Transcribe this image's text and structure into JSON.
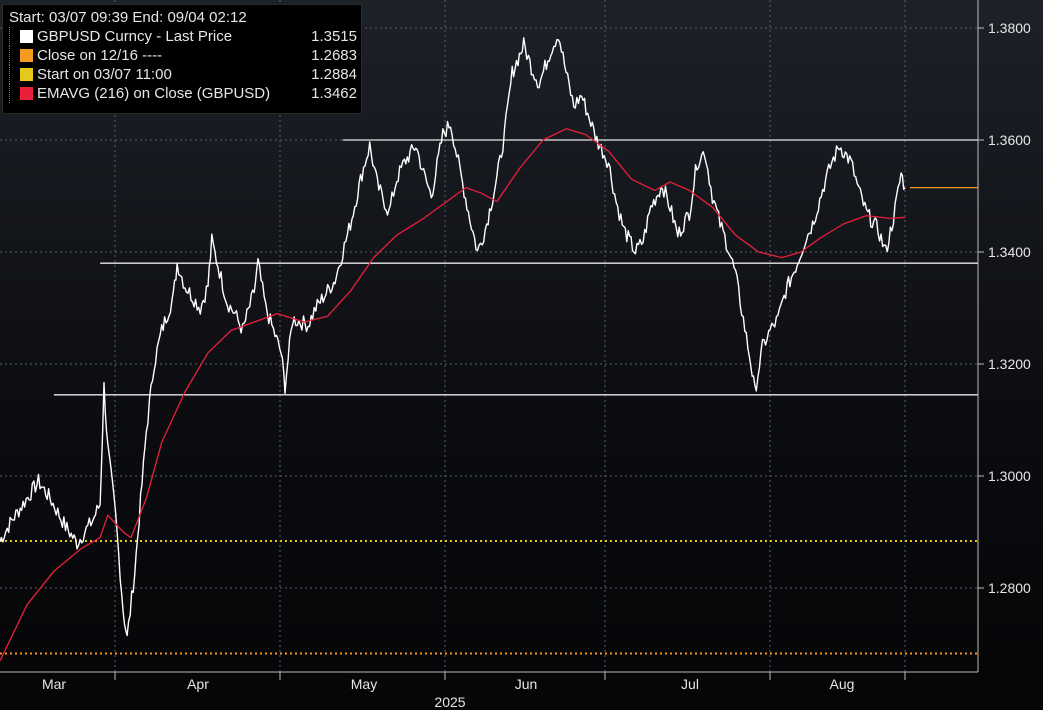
{
  "legend": {
    "header": "Start: 03/07 09:39 End: 09/04 02:12",
    "items": [
      {
        "label": "GBPUSD Curncy - Last Price",
        "value": "1.3515",
        "color": "#ffffff"
      },
      {
        "label": "Close on 12/16 ----",
        "value": "1.2683",
        "color": "#f59a1e"
      },
      {
        "label": "Start on 03/07 11:00",
        "value": "1.2884",
        "color": "#e5c819"
      },
      {
        "label": "EMAVG (216)  on Close (GBPUSD)",
        "value": "1.3462",
        "color": "#e8203a"
      }
    ]
  },
  "chart_data": {
    "type": "line",
    "title": "",
    "x_labels": [
      "Mar",
      "Apr",
      "May",
      "Jun",
      "Jul",
      "Aug"
    ],
    "year_label": "2025",
    "y_ticks": [
      "1.2800",
      "1.3000",
      "1.3200",
      "1.3400",
      "1.3600",
      "1.3800"
    ],
    "ylim": [
      1.265,
      1.385
    ],
    "grid": true,
    "series": [
      {
        "name": "GBPUSD Curncy - Last Price",
        "color": "#ffffff",
        "points": [
          [
            "03-07",
            1.2884
          ],
          [
            "03-10",
            1.292
          ],
          [
            "03-13",
            1.295
          ],
          [
            "03-17",
            1.299
          ],
          [
            "03-20",
            1.296
          ],
          [
            "03-24",
            1.291
          ],
          [
            "03-27",
            1.288
          ],
          [
            "03-31",
            1.292
          ],
          [
            "04-02",
            1.295
          ],
          [
            "04-03",
            1.316
          ],
          [
            "04-04",
            1.305
          ],
          [
            "04-06",
            1.293
          ],
          [
            "04-08",
            1.276
          ],
          [
            "04-09",
            1.271
          ],
          [
            "04-11",
            1.283
          ],
          [
            "04-14",
            1.308
          ],
          [
            "04-16",
            1.32
          ],
          [
            "04-18",
            1.326
          ],
          [
            "04-21",
            1.332
          ],
          [
            "04-22",
            1.338
          ],
          [
            "04-24",
            1.334
          ],
          [
            "04-28",
            1.33
          ],
          [
            "04-30",
            1.334
          ],
          [
            "05-01",
            1.342
          ],
          [
            "05-05",
            1.331
          ],
          [
            "05-07",
            1.329
          ],
          [
            "05-09",
            1.326
          ],
          [
            "05-12",
            1.333
          ],
          [
            "05-13",
            1.338
          ],
          [
            "05-15",
            1.33
          ],
          [
            "05-19",
            1.322
          ],
          [
            "05-20",
            1.316
          ],
          [
            "05-22",
            1.328
          ],
          [
            "05-26",
            1.327
          ],
          [
            "05-28",
            1.33
          ],
          [
            "06-02",
            1.335
          ],
          [
            "06-04",
            1.34
          ],
          [
            "06-06",
            1.345
          ],
          [
            "06-09",
            1.354
          ],
          [
            "06-11",
            1.359
          ],
          [
            "06-13",
            1.352
          ],
          [
            "06-16",
            1.347
          ],
          [
            "06-18",
            1.353
          ],
          [
            "06-20",
            1.356
          ],
          [
            "06-23",
            1.359
          ],
          [
            "06-25",
            1.354
          ],
          [
            "06-27",
            1.35
          ],
          [
            "06-30",
            1.361
          ],
          [
            "07-02",
            1.363
          ],
          [
            "07-04",
            1.356
          ],
          [
            "07-07",
            1.346
          ],
          [
            "07-09",
            1.34
          ],
          [
            "07-11",
            1.344
          ],
          [
            "07-14",
            1.353
          ],
          [
            "07-16",
            1.361
          ],
          [
            "07-18",
            1.372
          ],
          [
            "07-21",
            1.377
          ],
          [
            "07-23",
            1.373
          ],
          [
            "07-25",
            1.37
          ],
          [
            "07-28",
            1.376
          ],
          [
            "07-30",
            1.379
          ],
          [
            "08-01",
            1.372
          ],
          [
            "08-03",
            1.366
          ],
          [
            "08-05",
            1.368
          ],
          [
            "08-07",
            1.364
          ],
          [
            "08-09",
            1.36
          ],
          [
            "08-12",
            1.356
          ],
          [
            "08-14",
            1.349
          ],
          [
            "08-16",
            1.344
          ],
          [
            "08-19",
            1.34
          ],
          [
            "08-21",
            1.342
          ],
          [
            "08-23",
            1.348
          ],
          [
            "08-26",
            1.352
          ],
          [
            "08-28",
            1.348
          ],
          [
            "08-30",
            1.343
          ],
          [
            "09-02",
            1.347
          ],
          [
            "09-04",
            1.356
          ],
          [
            "09-06",
            1.358
          ],
          [
            "09-08",
            1.35
          ],
          [
            "09-10",
            1.345
          ],
          [
            "09-12",
            1.341
          ],
          [
            "09-14",
            1.336
          ],
          [
            "09-16",
            1.328
          ],
          [
            "09-18",
            1.32
          ],
          [
            "09-19",
            1.315
          ],
          [
            "09-21",
            1.323
          ],
          [
            "09-23",
            1.326
          ],
          [
            "09-25",
            1.328
          ],
          [
            "09-27",
            1.333
          ],
          [
            "09-30",
            1.338
          ],
          [
            "10-02",
            1.342
          ],
          [
            "10-04",
            1.345
          ],
          [
            "10-07",
            1.352
          ],
          [
            "10-09",
            1.356
          ],
          [
            "10-11",
            1.359
          ],
          [
            "10-14",
            1.356
          ],
          [
            "10-16",
            1.351
          ],
          [
            "10-18",
            1.347
          ],
          [
            "10-21",
            1.344
          ],
          [
            "10-23",
            1.34
          ],
          [
            "10-25",
            1.346
          ],
          [
            "10-27",
            1.354
          ],
          [
            "10-28",
            1.3515
          ]
        ]
      },
      {
        "name": "EMAVG (216)  on Close (GBPUSD)",
        "color": "#e8203a",
        "points": [
          [
            "03-07",
            1.267
          ],
          [
            "03-14",
            1.277
          ],
          [
            "03-21",
            1.283
          ],
          [
            "03-28",
            1.287
          ],
          [
            "04-02",
            1.289
          ],
          [
            "04-04",
            1.293
          ],
          [
            "04-08",
            1.29
          ],
          [
            "04-10",
            1.289
          ],
          [
            "04-14",
            1.296
          ],
          [
            "04-18",
            1.306
          ],
          [
            "04-24",
            1.315
          ],
          [
            "04-30",
            1.322
          ],
          [
            "05-06",
            1.326
          ],
          [
            "05-12",
            1.3275
          ],
          [
            "05-18",
            1.329
          ],
          [
            "05-25",
            1.3275
          ],
          [
            "05-31",
            1.3285
          ],
          [
            "06-06",
            1.333
          ],
          [
            "06-12",
            1.339
          ],
          [
            "06-18",
            1.343
          ],
          [
            "06-25",
            1.346
          ],
          [
            "07-01",
            1.349
          ],
          [
            "07-06",
            1.3515
          ],
          [
            "07-10",
            1.3505
          ],
          [
            "07-14",
            1.349
          ],
          [
            "07-20",
            1.355
          ],
          [
            "07-26",
            1.36
          ],
          [
            "08-01",
            1.362
          ],
          [
            "08-06",
            1.361
          ],
          [
            "08-12",
            1.358
          ],
          [
            "08-18",
            1.353
          ],
          [
            "08-24",
            1.351
          ],
          [
            "08-28",
            1.3525
          ],
          [
            "09-02",
            1.351
          ],
          [
            "09-08",
            1.348
          ],
          [
            "09-14",
            1.343
          ],
          [
            "09-20",
            1.34
          ],
          [
            "09-26",
            1.339
          ],
          [
            "10-01",
            1.34
          ],
          [
            "10-06",
            1.3425
          ],
          [
            "10-12",
            1.345
          ],
          [
            "10-18",
            1.3465
          ],
          [
            "10-24",
            1.346
          ],
          [
            "10-28",
            1.3462
          ]
        ]
      }
    ],
    "reference_lines": [
      {
        "name": "Start on 03/07 11:00",
        "value": 1.2884,
        "color": "#e5c819",
        "style": "dotted"
      },
      {
        "name": "Close on 12/16",
        "value": 1.2683,
        "color": "#f59a1e",
        "style": "dotted"
      }
    ],
    "support_resistance": [
      {
        "value": 1.36,
        "from": "06-04"
      },
      {
        "value": 1.338,
        "from": "04-02"
      },
      {
        "value": 1.3145,
        "from": "03-21"
      }
    ],
    "last_price_marker": {
      "value": 1.3515,
      "color": "#f59a1e"
    }
  }
}
